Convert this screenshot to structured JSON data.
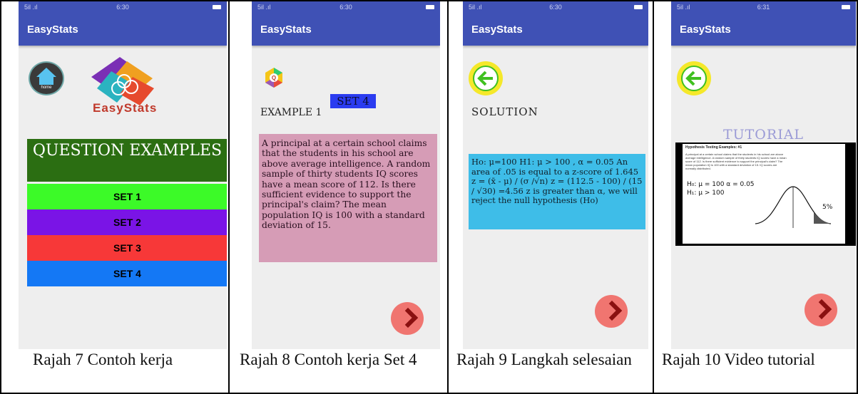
{
  "app_title": "EasyStats",
  "panels": [
    {
      "status_time": "6:30",
      "home_label": "home",
      "logo_text": "EasyStats",
      "heading": "QUESTION EXAMPLES",
      "sets": [
        "SET 1",
        "SET 2",
        "SET 3",
        "SET 4"
      ],
      "caption": "Rajah 7 Contoh kerja"
    },
    {
      "status_time": "6:30",
      "badge": "SET 4",
      "example_label": "EXAMPLE 1",
      "question": "A principal at a certain school claims that the students in his school are above average intelligence. A random sample of thirty students IQ scores have a mean score of 112. Is there sufficient evidence to support the principal's claim? The mean population IQ is 100 with a standard deviation of 15.",
      "caption": "Rajah 8 Contoh kerja Set 4"
    },
    {
      "status_time": "6:30",
      "heading": "SOLUTION",
      "solution": "Ho: μ=100 H1: μ > 100 , α = 0.05 An area of .05 is equal to a z-score of 1.645 z = (x̄ - μ) / (σ /√n) z = (112.5 - 100) / (15 / √30) =4.56 z is greater than α, we will reject the null hypothesis (Ho)",
      "caption": "Rajah 9 Langkah selesaian"
    },
    {
      "status_time": "6:31",
      "heading": "TUTORIAL",
      "video_title": "Hypothesis Testing Examples: #1",
      "video_text": "A principal at a certain school claims that the students in his school are above average intelligence. A random sample of thirty students IQ scores have a mean score of 112. Is there sufficient evidence to support the principal's claim? The mean population IQ is 100 with a standard deviation of 15. IQ scores are normally distributed.",
      "hand_h0": "H₀: μ = 100   α = 0.05",
      "hand_h1": "H₁: μ > 100",
      "hand_pct": "5%",
      "caption": "Rajah 10 Video tutorial"
    }
  ],
  "colors": {
    "appbar": "#3f51b5",
    "set1": "#3cfa28",
    "set2": "#7a14e6",
    "set3": "#f73838",
    "set4": "#1478f5",
    "question_box": "#d69cb6",
    "solution_box": "#3ebde8",
    "heading_bg": "#2b6e12"
  }
}
